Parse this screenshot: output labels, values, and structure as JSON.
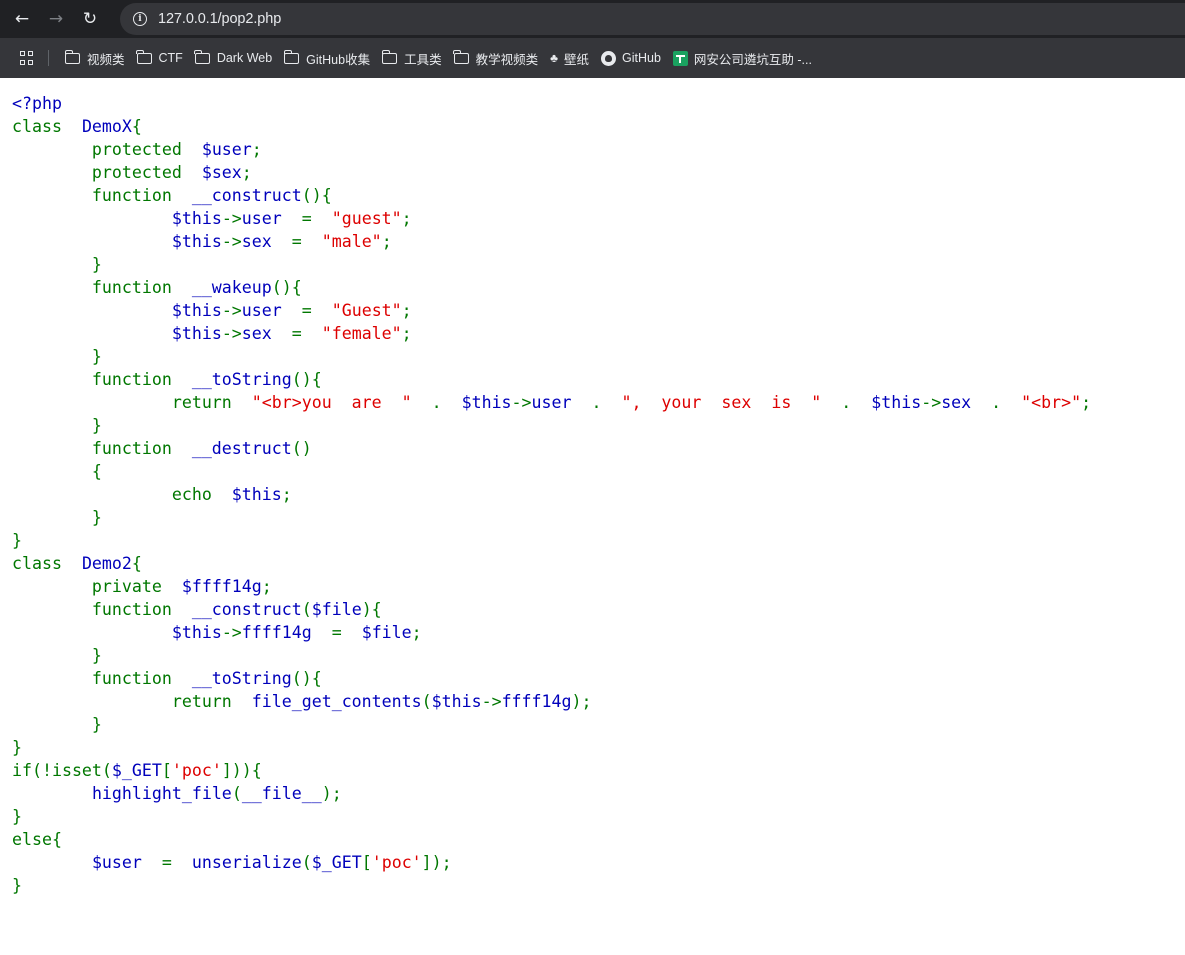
{
  "browser": {
    "url": "127.0.0.1/pop2.php",
    "nav": {
      "back": "←",
      "forward": "→",
      "reload": "↻",
      "info": "i"
    },
    "bookmarks": [
      {
        "label": "视频类",
        "icon": "folder-icon"
      },
      {
        "label": "CTF",
        "icon": "folder-icon"
      },
      {
        "label": "Dark Web",
        "icon": "folder-icon"
      },
      {
        "label": "GitHub收集",
        "icon": "folder-icon"
      },
      {
        "label": "工具类",
        "icon": "folder-icon"
      },
      {
        "label": "教学视频类",
        "icon": "folder-icon"
      },
      {
        "label": "壁纸",
        "icon": "wallpaper-icon"
      },
      {
        "label": "GitHub",
        "icon": "github-icon"
      },
      {
        "label": "网安公司遴坑互助 -...",
        "icon": "sheets-icon"
      }
    ]
  },
  "colors": {
    "keyword": "#007700",
    "default": "#0000BB",
    "string": "#DD0000",
    "html": "#000000"
  },
  "code": {
    "lines": [
      [
        [
          "d",
          "<?php"
        ]
      ],
      [
        [
          "k",
          "class  "
        ],
        [
          "d",
          "DemoX"
        ],
        [
          "k",
          "{"
        ]
      ],
      [
        [
          "k",
          "        protected  "
        ],
        [
          "d",
          "$user"
        ],
        [
          "k",
          ";"
        ]
      ],
      [
        [
          "k",
          "        protected  "
        ],
        [
          "d",
          "$sex"
        ],
        [
          "k",
          ";"
        ]
      ],
      [
        [
          "k",
          "        function  "
        ],
        [
          "d",
          "__construct"
        ],
        [
          "k",
          "(){"
        ]
      ],
      [
        [
          "k",
          "                "
        ],
        [
          "d",
          "$this"
        ],
        [
          "k",
          "->"
        ],
        [
          "d",
          "user  "
        ],
        [
          "k",
          "=  "
        ],
        [
          "s",
          "\"guest\""
        ],
        [
          "k",
          ";"
        ]
      ],
      [
        [
          "k",
          "                "
        ],
        [
          "d",
          "$this"
        ],
        [
          "k",
          "->"
        ],
        [
          "d",
          "sex  "
        ],
        [
          "k",
          "=  "
        ],
        [
          "s",
          "\"male\""
        ],
        [
          "k",
          ";"
        ]
      ],
      [
        [
          "k",
          "        }"
        ]
      ],
      [
        [
          "k",
          "        function  "
        ],
        [
          "d",
          "__wakeup"
        ],
        [
          "k",
          "(){"
        ]
      ],
      [
        [
          "k",
          "                "
        ],
        [
          "d",
          "$this"
        ],
        [
          "k",
          "->"
        ],
        [
          "d",
          "user  "
        ],
        [
          "k",
          "=  "
        ],
        [
          "s",
          "\"Guest\""
        ],
        [
          "k",
          ";"
        ]
      ],
      [
        [
          "k",
          "                "
        ],
        [
          "d",
          "$this"
        ],
        [
          "k",
          "->"
        ],
        [
          "d",
          "sex  "
        ],
        [
          "k",
          "=  "
        ],
        [
          "s",
          "\"female\""
        ],
        [
          "k",
          ";"
        ]
      ],
      [
        [
          "k",
          "        }"
        ]
      ],
      [
        [
          "k",
          "        function  "
        ],
        [
          "d",
          "__toString"
        ],
        [
          "k",
          "(){"
        ]
      ],
      [
        [
          "k",
          "                return  "
        ],
        [
          "s",
          "\"<br>you  are  \"  "
        ],
        [
          "k",
          ".  "
        ],
        [
          "d",
          "$this"
        ],
        [
          "k",
          "->"
        ],
        [
          "d",
          "user  "
        ],
        [
          "k",
          ".  "
        ],
        [
          "s",
          "\",  your  sex  is  \"  "
        ],
        [
          "k",
          ".  "
        ],
        [
          "d",
          "$this"
        ],
        [
          "k",
          "->"
        ],
        [
          "d",
          "sex  "
        ],
        [
          "k",
          ".  "
        ],
        [
          "s",
          "\"<br>\""
        ],
        [
          "k",
          ";"
        ]
      ],
      [
        [
          "k",
          "        }"
        ]
      ],
      [
        [
          "k",
          "        function  "
        ],
        [
          "d",
          "__destruct"
        ],
        [
          "k",
          "()"
        ]
      ],
      [
        [
          "k",
          "        {"
        ]
      ],
      [
        [
          "k",
          "                echo  "
        ],
        [
          "d",
          "$this"
        ],
        [
          "k",
          ";"
        ]
      ],
      [
        [
          "k",
          "        }"
        ]
      ],
      [
        [
          "k",
          "}"
        ]
      ],
      [
        [
          "k",
          "class  "
        ],
        [
          "d",
          "Demo2"
        ],
        [
          "k",
          "{"
        ]
      ],
      [
        [
          "k",
          "        private  "
        ],
        [
          "d",
          "$ffff14g"
        ],
        [
          "k",
          ";"
        ]
      ],
      [
        [
          "k",
          "        function  "
        ],
        [
          "d",
          "__construct"
        ],
        [
          "k",
          "("
        ],
        [
          "d",
          "$file"
        ],
        [
          "k",
          "){"
        ]
      ],
      [
        [
          "k",
          "                "
        ],
        [
          "d",
          "$this"
        ],
        [
          "k",
          "->"
        ],
        [
          "d",
          "ffff14g  "
        ],
        [
          "k",
          "=  "
        ],
        [
          "d",
          "$file"
        ],
        [
          "k",
          ";"
        ]
      ],
      [
        [
          "k",
          "        }"
        ]
      ],
      [
        [
          "k",
          "        function  "
        ],
        [
          "d",
          "__toString"
        ],
        [
          "k",
          "(){"
        ]
      ],
      [
        [
          "k",
          "                return  "
        ],
        [
          "d",
          "file_get_contents"
        ],
        [
          "k",
          "("
        ],
        [
          "d",
          "$this"
        ],
        [
          "k",
          "->"
        ],
        [
          "d",
          "ffff14g"
        ],
        [
          "k",
          ");"
        ]
      ],
      [
        [
          "k",
          "        }"
        ]
      ],
      [
        [
          "k",
          "}"
        ]
      ],
      [
        [
          "k",
          "if(!isset("
        ],
        [
          "d",
          "$_GET"
        ],
        [
          "k",
          "["
        ],
        [
          "s",
          "'poc'"
        ],
        [
          "k",
          "])){"
        ]
      ],
      [
        [
          "k",
          "        "
        ],
        [
          "d",
          "highlight_file"
        ],
        [
          "k",
          "("
        ],
        [
          "d",
          "__file__"
        ],
        [
          "k",
          ");"
        ]
      ],
      [
        [
          "k",
          "}"
        ]
      ],
      [
        [
          "k",
          "else{"
        ]
      ],
      [
        [
          "k",
          "        "
        ],
        [
          "d",
          "$user  "
        ],
        [
          "k",
          "=  "
        ],
        [
          "d",
          "unserialize"
        ],
        [
          "k",
          "("
        ],
        [
          "d",
          "$_GET"
        ],
        [
          "k",
          "["
        ],
        [
          "s",
          "'poc'"
        ],
        [
          "k",
          "]);"
        ]
      ],
      [
        [
          "k",
          "}"
        ]
      ]
    ]
  }
}
